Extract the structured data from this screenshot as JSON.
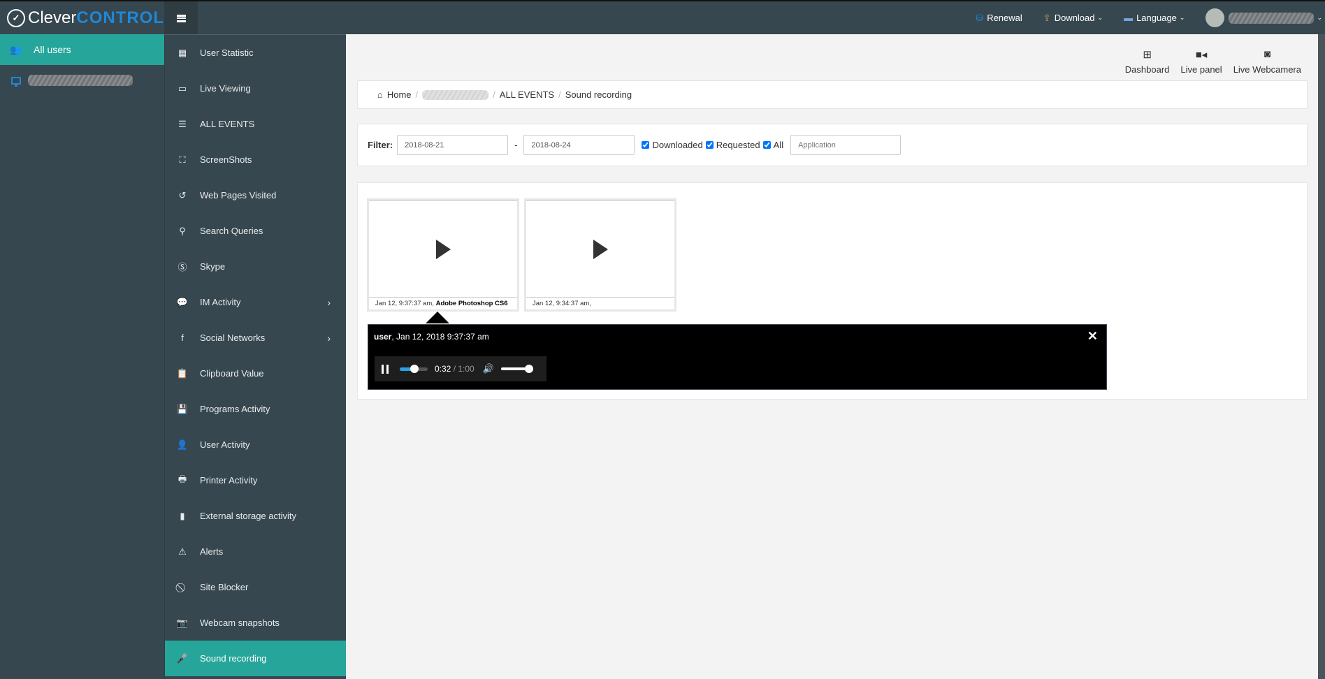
{
  "header": {
    "logo_left": "Clever",
    "logo_right": "CONTROL",
    "nav": [
      {
        "label": "Renewal",
        "icon": "database-icon",
        "color": "#1e88d8"
      },
      {
        "label": "Download",
        "icon": "upload-tray-icon",
        "color": "#c9a24a"
      },
      {
        "label": "Language",
        "icon": "flag-icon",
        "color": "#6fa8dc"
      }
    ],
    "caret": "⌄"
  },
  "left_panel": {
    "all_users_label": "All users"
  },
  "menu": {
    "items": [
      {
        "label": "User Statistic",
        "icon": "▦"
      },
      {
        "label": "Live Viewing",
        "icon": "▭"
      },
      {
        "label": "ALL EVENTS",
        "icon": "☰"
      },
      {
        "label": "ScreenShots",
        "icon": "⛶"
      },
      {
        "label": "Web Pages Visited",
        "icon": "↺"
      },
      {
        "label": "Search Queries",
        "icon": "⚲"
      },
      {
        "label": "Skype",
        "icon": "Ⓢ"
      },
      {
        "label": "IM Activity",
        "icon": "💬",
        "arrow": "›"
      },
      {
        "label": "Social Networks",
        "icon": "f",
        "arrow": "›"
      },
      {
        "label": "Clipboard Value",
        "icon": "📋"
      },
      {
        "label": "Programs Activity",
        "icon": "💾"
      },
      {
        "label": "User Activity",
        "icon": "👤"
      },
      {
        "label": "Printer Activity",
        "icon": "🖶"
      },
      {
        "label": "External storage activity",
        "icon": "▮"
      },
      {
        "label": "Alerts",
        "icon": "⚠"
      },
      {
        "label": "Site Blocker",
        "icon": "⃠"
      },
      {
        "label": "Webcam snapshots",
        "icon": "📷"
      },
      {
        "label": "Sound recording",
        "icon": "🎤",
        "active": true
      }
    ]
  },
  "quick_links": [
    {
      "label": "Dashboard",
      "icon": "⊞"
    },
    {
      "label": "Live panel",
      "icon": "■◂"
    },
    {
      "label": "Live Webcamera",
      "icon": "◙"
    }
  ],
  "breadcrumb": {
    "home": "Home",
    "level2": "ALL EVENTS",
    "current": "Sound recording",
    "separator": "/"
  },
  "filter": {
    "label": "Filter:",
    "date_from": "2018-08-21",
    "date_to": "2018-08-24",
    "dash": "-",
    "checkboxes": [
      {
        "label": "Downloaded",
        "checked": true
      },
      {
        "label": "Requested",
        "checked": true
      },
      {
        "label": "All",
        "checked": true
      }
    ],
    "application_placeholder": "Application"
  },
  "recordings": [
    {
      "time": "Jan 12, 9:37:37 am,",
      "app": "Adobe Photoshop CS6"
    },
    {
      "time": "Jan 12, 9:34:37 am,",
      "app": ""
    }
  ],
  "player": {
    "user": "user",
    "datetime": ", Jan 12, 2018 9:37:37 am",
    "current_time": "0:32",
    "duration": "1:00",
    "time_sep": " / ",
    "progress": 0.53,
    "volume": 1.0,
    "close": "✕"
  },
  "colors": {
    "accent": "#26a69a",
    "sidebar": "#37474f",
    "brand_blue": "#1e88d8"
  }
}
